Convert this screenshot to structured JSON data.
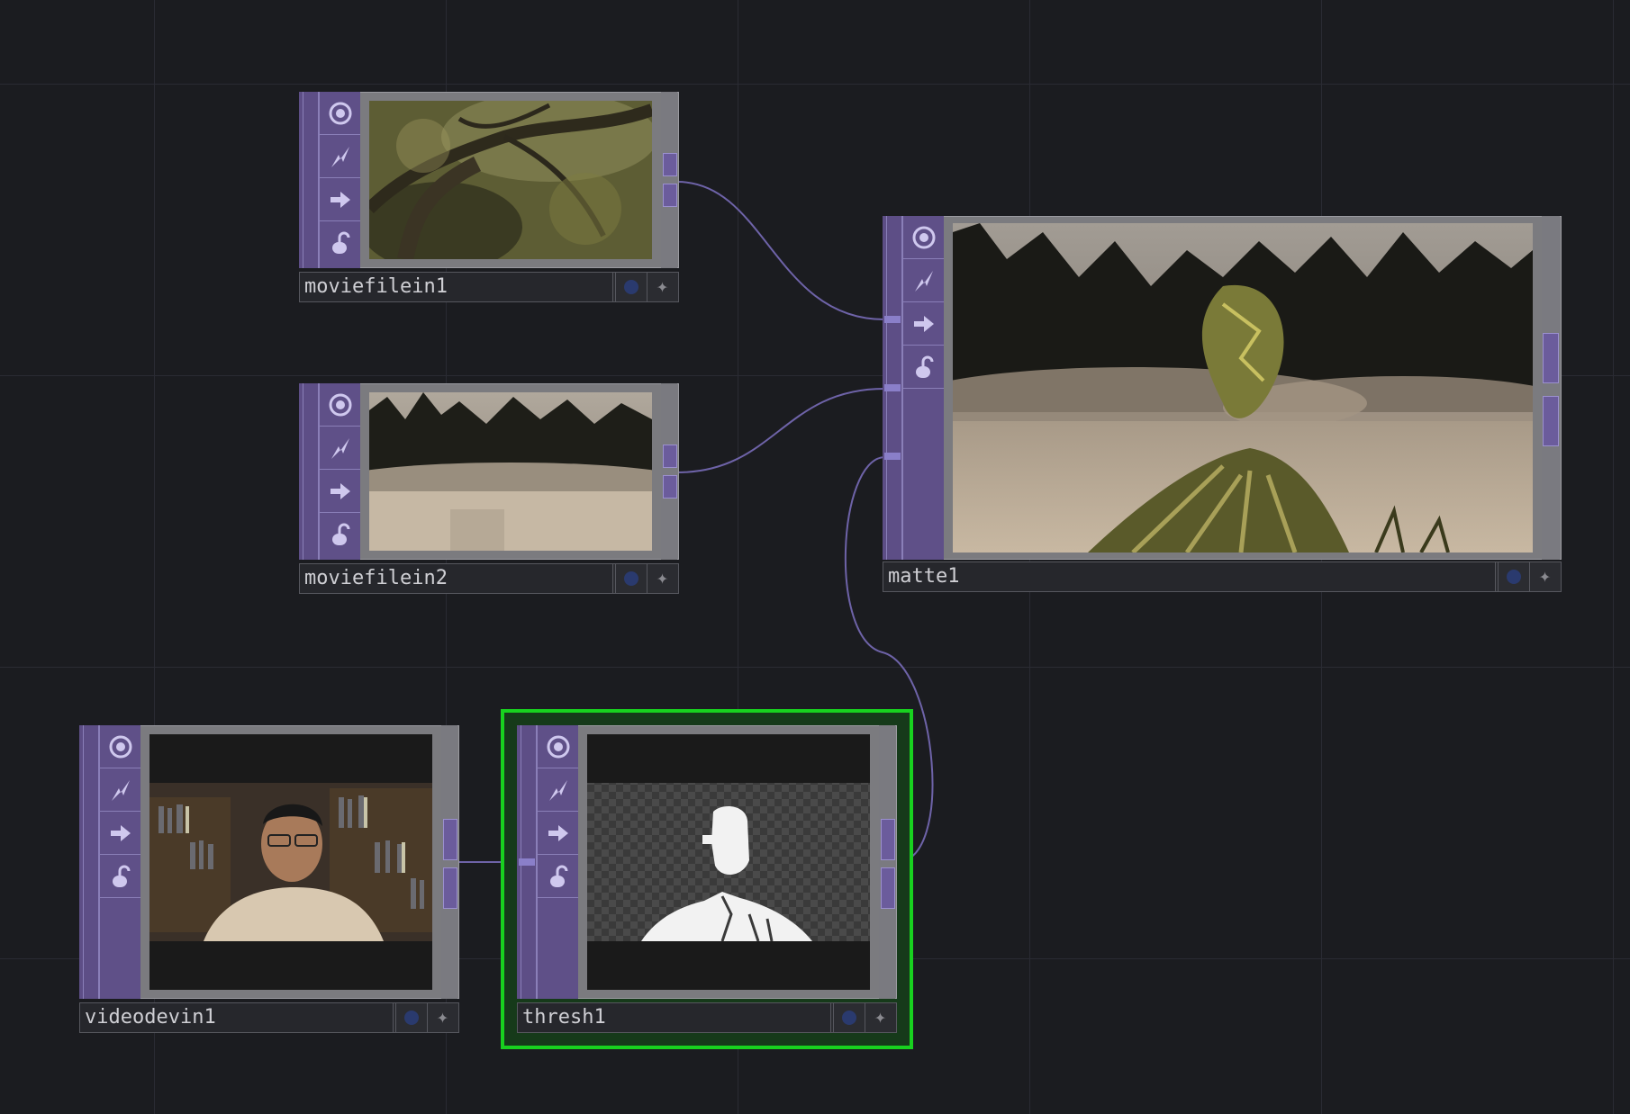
{
  "app": "TouchDesigner network editor",
  "colors": {
    "background": "#1b1c20",
    "operator_family": "#5d4e86",
    "wire": "#6e63a8",
    "selected": "#18d11f"
  },
  "icon_names": [
    "viewer-toggle-icon",
    "cook-icon",
    "bypass-icon",
    "lock-icon"
  ],
  "nodes": {
    "moviefilein1": {
      "name": "moviefilein1",
      "preview": "forest tree branches"
    },
    "moviefilein2": {
      "name": "moviefilein2",
      "preview": "misty lake with trees"
    },
    "matte1": {
      "name": "matte1",
      "preview": "composited misty lake with tree texture silhouette"
    },
    "videodevin1": {
      "name": "videodevin1",
      "preview": "webcam man with glasses in front of bookshelf"
    },
    "thresh1": {
      "name": "thresh1",
      "preview": "threshold white silhouette on checkerboard",
      "selected": true
    }
  }
}
